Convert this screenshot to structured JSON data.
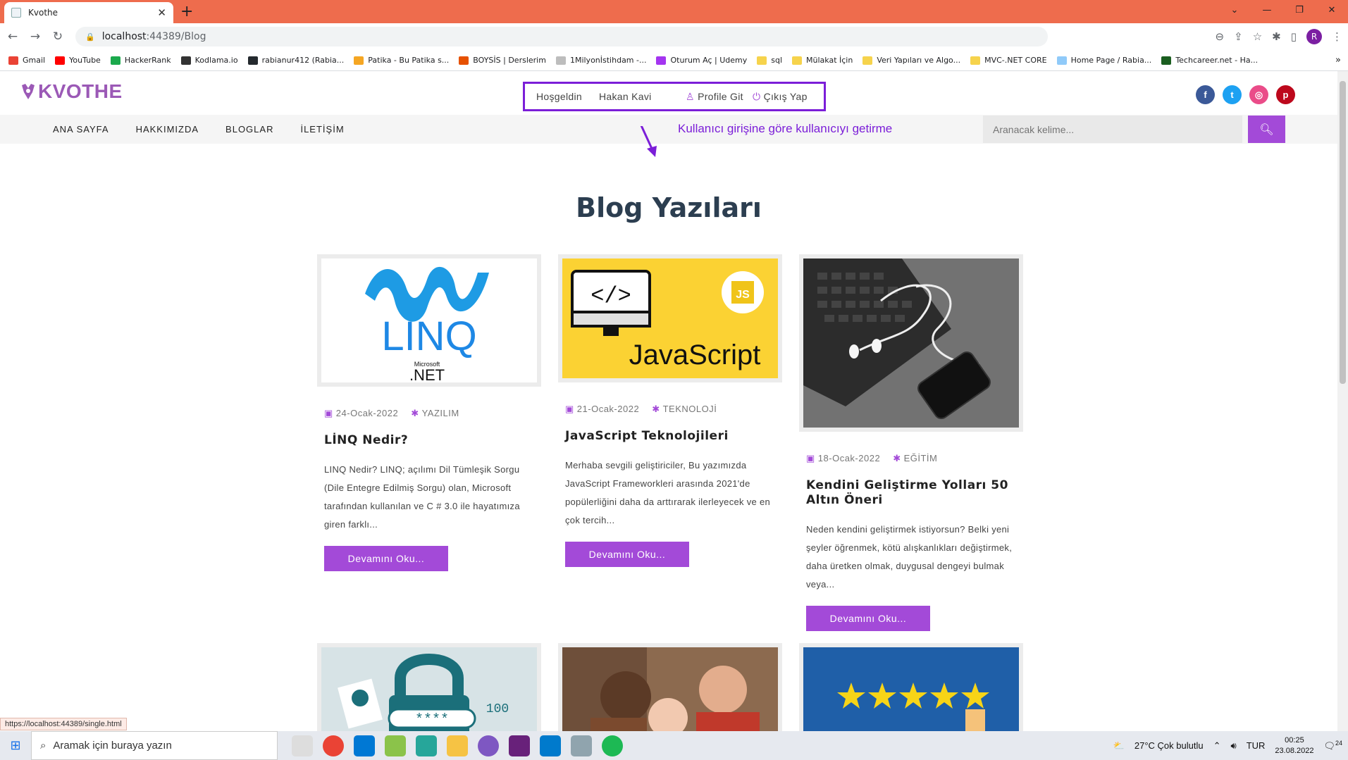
{
  "browser": {
    "tab_title": "Kvothe",
    "url_host": "localhost",
    "url_path": ":44389/Blog",
    "avatar_letter": "R",
    "bookmarks": [
      {
        "label": "Gmail",
        "color": "#ea4335"
      },
      {
        "label": "YouTube",
        "color": "#ff0000"
      },
      {
        "label": "HackerRank",
        "color": "#1ba94c"
      },
      {
        "label": "Kodlama.io",
        "color": "#333333"
      },
      {
        "label": "rabianur412 (Rabia...",
        "color": "#24292e"
      },
      {
        "label": "Patika - Bu Patika s...",
        "color": "#f5a623"
      },
      {
        "label": "BOYSİS | Derslerim",
        "color": "#e65100"
      },
      {
        "label": "1Milyonİstihdam -...",
        "color": "#bdbdbd"
      },
      {
        "label": "Oturum Aç | Udemy",
        "color": "#a435f0"
      },
      {
        "label": "sql",
        "color": "#f6d34c"
      },
      {
        "label": "Mülakat İçin",
        "color": "#f6d34c"
      },
      {
        "label": "Veri Yapıları ve Algo...",
        "color": "#f6d34c"
      },
      {
        "label": "MVC-.NET CORE",
        "color": "#f6d34c"
      },
      {
        "label": "Home Page / Rabia...",
        "color": "#90caf9"
      },
      {
        "label": "Techcareer.net - Ha...",
        "color": "#1b5e20"
      }
    ]
  },
  "site": {
    "logo": "KVOTHE",
    "welcome": "Hoşgeldin",
    "user_name": "Hakan Kavi",
    "profile_link": "Profile Git",
    "logout_link": "Çıkış Yap",
    "annotation": "Kullanıcı girişine göre kullanıcıyı getirme",
    "social": [
      {
        "icon": "facebook-icon",
        "glyph": "f",
        "color": "#3b5998"
      },
      {
        "icon": "twitter-icon",
        "glyph": "t",
        "color": "#1da1f2"
      },
      {
        "icon": "dribbble-icon",
        "glyph": "◎",
        "color": "#ea4c89"
      },
      {
        "icon": "pinterest-icon",
        "glyph": "p",
        "color": "#bd081c"
      }
    ],
    "menu": [
      "ANA SAYFA",
      "HAKKIMIZDA",
      "BLOGLAR",
      "İLETİŞİM"
    ],
    "search_placeholder": "Aranacak kelime...",
    "page_title": "Blog Yazıları"
  },
  "posts": [
    {
      "date": "24-Ocak-2022",
      "category": "YAZILIM",
      "title": "LİNQ Nedir?",
      "excerpt": "LINQ Nedir? LINQ; açılımı Dil Tümleşik Sorgu (Dile Entegre Edilmiş Sorgu) olan, Microsoft tarafından kullanılan ve C # 3.0 ile hayatımıza giren farklı...",
      "button": "Devamını Oku..."
    },
    {
      "date": "21-Ocak-2022",
      "category": "TEKNOLOJİ",
      "title": "JavaScript Teknolojileri",
      "excerpt": "Merhaba sevgili geliştiriciler, Bu yazımızda JavaScript Frameworkleri arasında 2021'de popülerliğini daha da arttırarak ilerleyecek ve en çok tercih...",
      "button": "Devamını Oku..."
    },
    {
      "date": "18-Ocak-2022",
      "category": "EĞİTİM",
      "title": "Kendini Geliştirme Yolları 50 Altın Öneri",
      "excerpt": "Neden kendini geliştirmek istiyorsun? Belki yeni şeyler öğrenmek, kötü alışkanlıkları değiştirmek, daha üretken olmak, duygusal dengeyi bulmak veya...",
      "button": "Devamını Oku..."
    }
  ],
  "images": {
    "linq_text": "LINQ",
    "net_text": ".NET",
    "microsoft_text": "Microsoft",
    "js_text": "JavaScript",
    "js_badge": "JS",
    "code_tag": "</>",
    "password_stars": "****",
    "binary": "100"
  },
  "status_url": "https://localhost:44389/single.html",
  "taskbar": {
    "search_placeholder": "Aramak için buraya yazın",
    "weather": "27°C  Çok bulutlu",
    "language": "TUR",
    "time": "00:25",
    "date": "23.08.2022",
    "notifications": "24"
  }
}
